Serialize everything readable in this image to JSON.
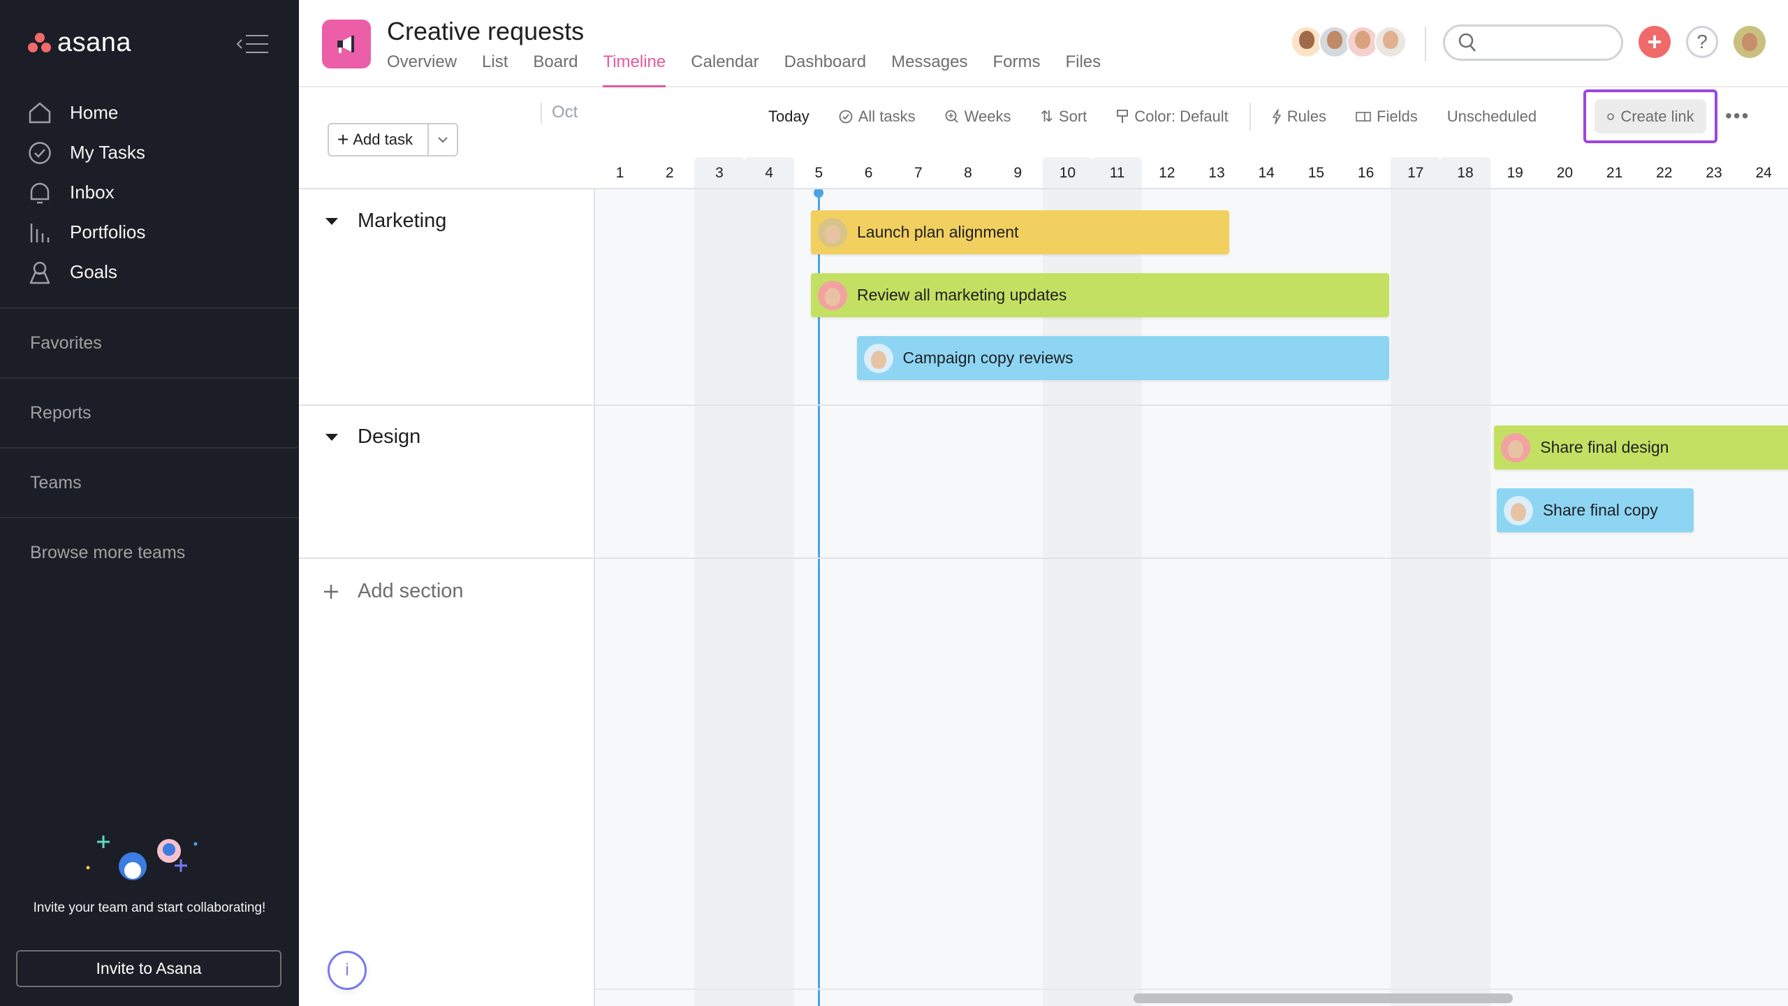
{
  "sidebar": {
    "logo_text": "asana",
    "nav": [
      {
        "label": "Home",
        "icon": "home-icon"
      },
      {
        "label": "My Tasks",
        "icon": "check-circle-icon"
      },
      {
        "label": "Inbox",
        "icon": "bell-icon"
      },
      {
        "label": "Portfolios",
        "icon": "bar-chart-icon"
      },
      {
        "label": "Goals",
        "icon": "person-icon"
      }
    ],
    "sections": [
      "Favorites",
      "Reports",
      "Teams",
      "Browse more teams"
    ],
    "invite_text": "Invite your team and start collaborating!",
    "invite_button": "Invite to Asana"
  },
  "header": {
    "project_title": "Creative requests",
    "tabs": [
      {
        "label": "Overview",
        "active": false
      },
      {
        "label": "List",
        "active": false
      },
      {
        "label": "Board",
        "active": false
      },
      {
        "label": "Timeline",
        "active": true
      },
      {
        "label": "Calendar",
        "active": false
      },
      {
        "label": "Dashboard",
        "active": false
      },
      {
        "label": "Messages",
        "active": false
      },
      {
        "label": "Forms",
        "active": false
      },
      {
        "label": "Files",
        "active": false
      }
    ],
    "search_placeholder": "",
    "member_count": 4,
    "accent_color": "#e8599c"
  },
  "toolbar": {
    "add_task": "Add task",
    "month": "Oct",
    "today": "Today",
    "all_tasks": "All tasks",
    "weeks": "Weeks",
    "sort": "Sort",
    "color": "Color: Default",
    "rules": "Rules",
    "fields": "Fields",
    "unscheduled": "Unscheduled",
    "create_link": "Create link",
    "more": "•••"
  },
  "timeline": {
    "days": [
      1,
      2,
      3,
      4,
      5,
      6,
      7,
      8,
      9,
      10,
      11,
      12,
      13,
      14,
      15,
      16,
      17,
      18,
      19,
      20,
      21,
      22,
      23,
      24
    ],
    "weekend_days": [
      3,
      4,
      10,
      11,
      17,
      18
    ],
    "today_day": 5,
    "sections": [
      {
        "name": "Marketing",
        "tasks": [
          {
            "name": "Launch plan alignment",
            "start": 5.34,
            "end": 13.75,
            "color": "#f2d060",
            "avatar": "#d8c487",
            "lane": 0
          },
          {
            "name": "Review all marketing updates",
            "start": 5.34,
            "end": 16.97,
            "color": "#c4e062",
            "avatar": "#f3a1a1",
            "lane": 1
          },
          {
            "name": "Campaign copy reviews",
            "start": 6.26,
            "end": 16.97,
            "color": "#8ed5f3",
            "avatar": "#dbeefb",
            "lane": 2
          }
        ]
      },
      {
        "name": "Design",
        "tasks": [
          {
            "name": "Share final design",
            "start": 19.08,
            "end": 25.5,
            "color": "#c4e062",
            "avatar": "#f3a1a1",
            "lane": 0
          },
          {
            "name": "Share final copy",
            "start": 19.13,
            "end": 23.09,
            "color": "#8ed5f3",
            "avatar": "#dbeefb",
            "lane": 1
          }
        ]
      }
    ],
    "add_section": "Add section"
  }
}
